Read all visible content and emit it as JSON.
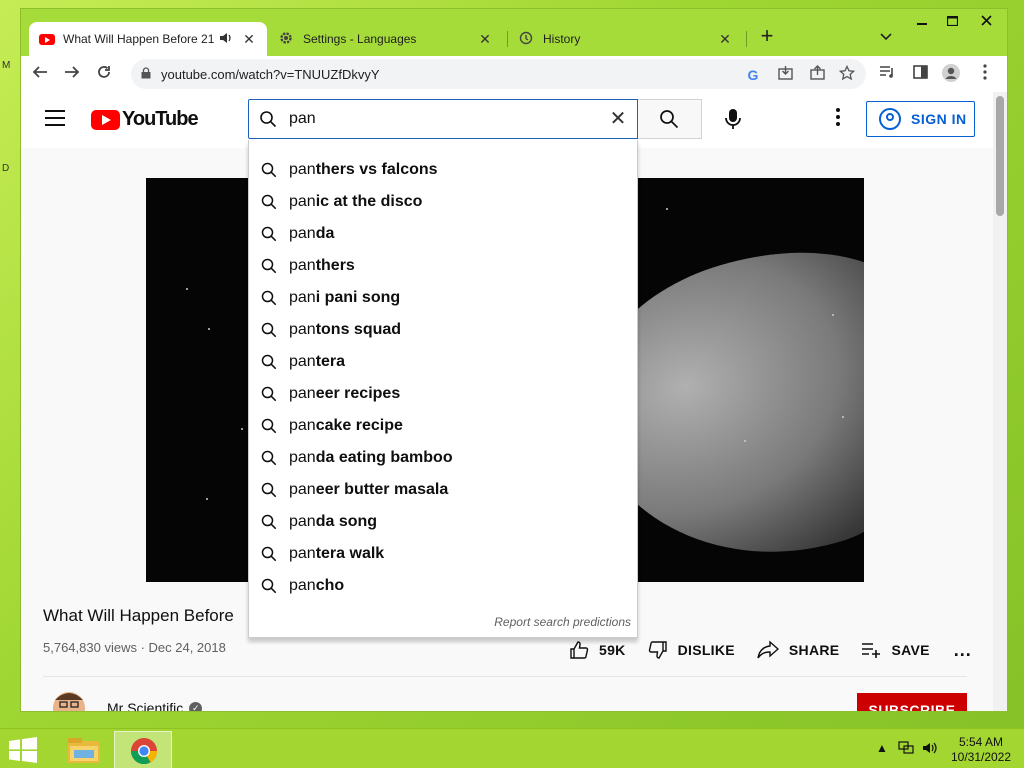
{
  "browser": {
    "tabs": [
      {
        "title": "What Will Happen Before 21",
        "active": true
      },
      {
        "title": "Settings - Languages",
        "active": false
      },
      {
        "title": "History",
        "active": false
      }
    ],
    "url": "youtube.com/watch?v=TNUUZfDkvyY"
  },
  "youtube": {
    "logo_text": "YouTube",
    "search_value": "pan",
    "signin_label": "SIGN IN",
    "suggestions": [
      {
        "typed": "pan",
        "rest": "thers vs falcons"
      },
      {
        "typed": "pan",
        "rest": "ic at the disco"
      },
      {
        "typed": "pan",
        "rest": "da"
      },
      {
        "typed": "pan",
        "rest": "thers"
      },
      {
        "typed": "pan",
        "rest": "i pani song"
      },
      {
        "typed": "pan",
        "rest": "tons squad"
      },
      {
        "typed": "pan",
        "rest": "tera"
      },
      {
        "typed": "pan",
        "rest": "eer recipes"
      },
      {
        "typed": "pan",
        "rest": "cake recipe"
      },
      {
        "typed": "pan",
        "rest": "da eating bamboo"
      },
      {
        "typed": "pan",
        "rest": "eer butter masala"
      },
      {
        "typed": "pan",
        "rest": "da song"
      },
      {
        "typed": "pan",
        "rest": "tera walk"
      },
      {
        "typed": "pan",
        "rest": "cho"
      }
    ],
    "report_label": "Report search predictions",
    "video_title": "What Will Happen Before",
    "video_meta": "5,764,830 views · Dec 24, 2018",
    "actions": {
      "like": "59K",
      "dislike": "DISLIKE",
      "share": "SHARE",
      "save": "SAVE",
      "more": "..."
    },
    "channel_name": "Mr Scientific",
    "subscribe_label": "SUBSCRIBE"
  },
  "taskbar": {
    "time": "5:54 AM",
    "date": "10/31/2022"
  },
  "desktop": {
    "letters": [
      "M",
      "D"
    ]
  },
  "colors": {
    "desktop": "#a4d83a",
    "youtube_red": "#ff0000",
    "link_blue": "#065fd4",
    "subscribe_red": "#cc0000"
  }
}
